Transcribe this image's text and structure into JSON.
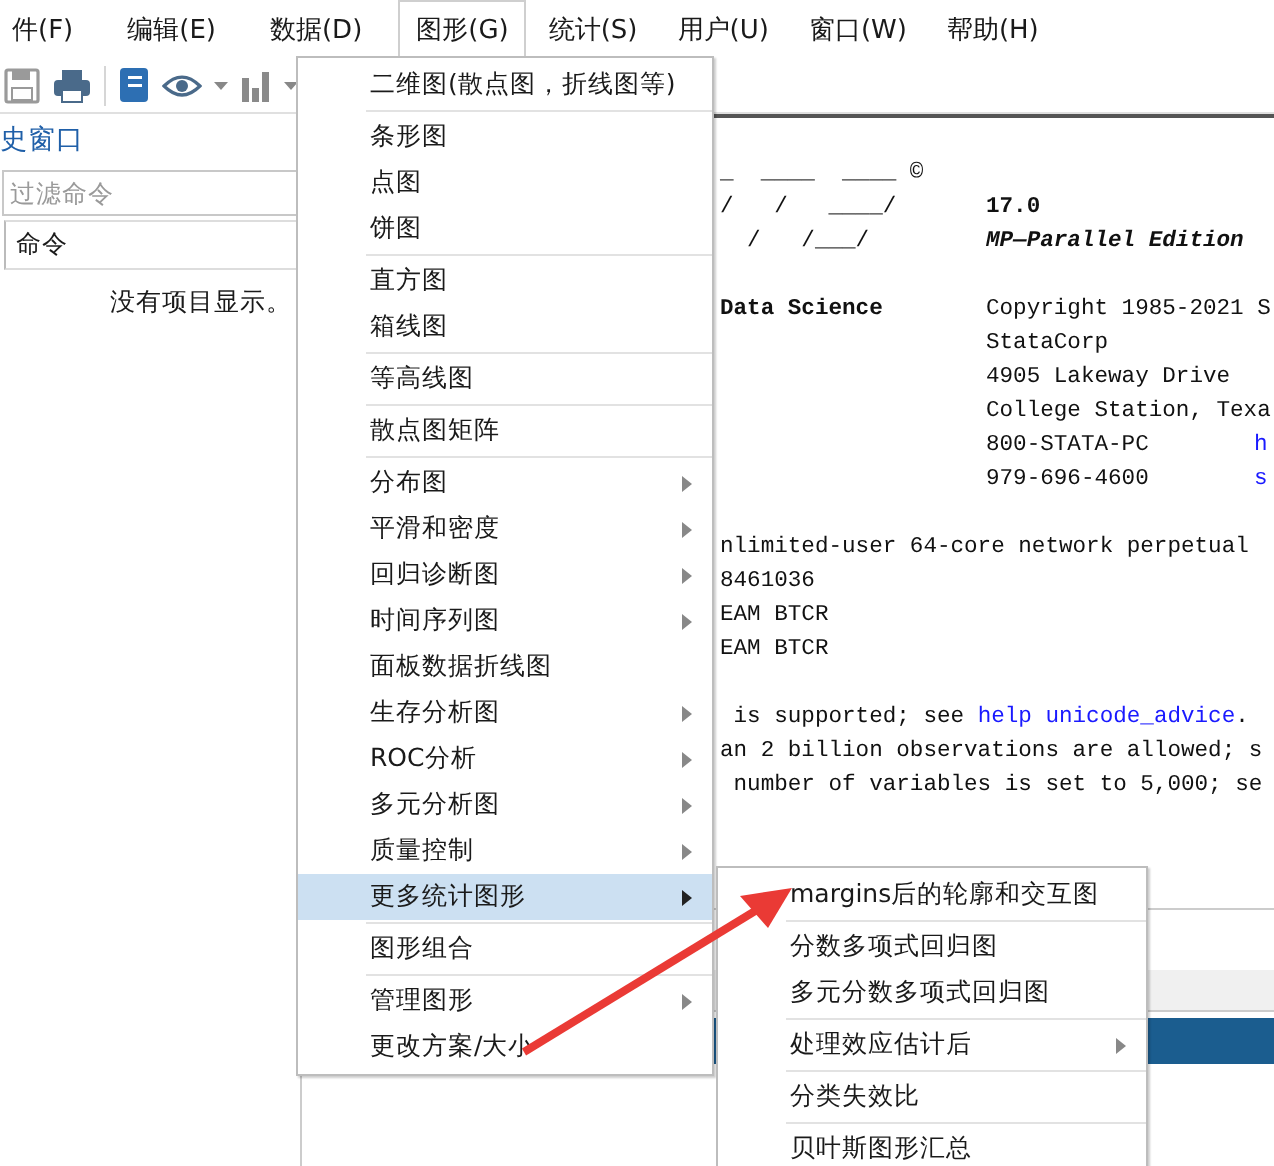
{
  "menubar": [
    {
      "label": "件(F)",
      "selected": false
    },
    {
      "label": "编辑(E)",
      "selected": false
    },
    {
      "label": "数据(D)",
      "selected": false
    },
    {
      "label": "图形(G)",
      "selected": true
    },
    {
      "label": "统计(S)",
      "selected": false
    },
    {
      "label": "用户(U)",
      "selected": false
    },
    {
      "label": "窗口(W)",
      "selected": false
    },
    {
      "label": "帮助(H)",
      "selected": false
    }
  ],
  "history_panel": {
    "title": "史窗口",
    "filter": {
      "placeholder": "过滤命令"
    },
    "column": "命令",
    "empty_message": "没有项目显示。"
  },
  "results": {
    "lines": [
      {
        "kind": "columns",
        "left": {
          "text": "_  ____  ____ ©",
          "kind": "text"
        }
      },
      {
        "kind": "columns",
        "left": {
          "text": "/   /   ____/",
          "kind": "text"
        },
        "middle": {
          "text": "17.0",
          "kind": "version"
        }
      },
      {
        "kind": "columns",
        "left": {
          "text": "  /   /___/",
          "kind": "text"
        },
        "middle": {
          "text": "MP—Parallel Edition",
          "kind": "edition"
        }
      },
      {
        "kind": "blank"
      },
      {
        "kind": "columns",
        "left": {
          "text": "Data Science",
          "kind": "version"
        },
        "middle": {
          "text": "Copyright 1985-2021 S",
          "kind": "text"
        }
      },
      {
        "kind": "columns",
        "middle": {
          "text": "StataCorp",
          "kind": "text"
        }
      },
      {
        "kind": "columns",
        "middle": {
          "text": "4905 Lakeway Drive",
          "kind": "text"
        }
      },
      {
        "kind": "columns",
        "middle": {
          "text": "College Station, Texa",
          "kind": "text"
        }
      },
      {
        "kind": "columns",
        "middle": {
          "text": "800-STATA-PC",
          "kind": "text"
        },
        "right": {
          "text": "h",
          "kind": "link"
        }
      },
      {
        "kind": "columns",
        "middle": {
          "text": "979-696-4600",
          "kind": "text"
        },
        "right": {
          "text": "s",
          "kind": "link"
        }
      },
      {
        "kind": "blank"
      },
      {
        "kind": "text",
        "text": "nlimited-user 64-core network perpetual"
      },
      {
        "kind": "text",
        "text": "8461036"
      },
      {
        "kind": "text",
        "text": "EAM BTCR"
      },
      {
        "kind": "text",
        "text": "EAM BTCR"
      },
      {
        "kind": "blank"
      },
      {
        "kind": "sentence",
        "before": " is supported; see ",
        "link": "help unicode_advice",
        "after": "."
      },
      {
        "kind": "text",
        "text": "an 2 billion observations are allowed; s"
      },
      {
        "kind": "text",
        "text": " number of variables is set to 5,000; se"
      }
    ]
  },
  "graphics_menu": {
    "groups": [
      [
        {
          "label": "二维图(散点图，折线图等)",
          "submenu": false,
          "selected": false
        }
      ],
      [
        {
          "label": "条形图",
          "submenu": false,
          "selected": false
        },
        {
          "label": "点图",
          "submenu": false,
          "selected": false
        },
        {
          "label": "饼图",
          "submenu": false,
          "selected": false
        }
      ],
      [
        {
          "label": "直方图",
          "submenu": false,
          "selected": false
        },
        {
          "label": "箱线图",
          "submenu": false,
          "selected": false
        }
      ],
      [
        {
          "label": "等高线图",
          "submenu": false,
          "selected": false
        }
      ],
      [
        {
          "label": "散点图矩阵",
          "submenu": false,
          "selected": false
        }
      ],
      [
        {
          "label": "分布图",
          "submenu": true,
          "selected": false
        },
        {
          "label": "平滑和密度",
          "submenu": true,
          "selected": false
        },
        {
          "label": "回归诊断图",
          "submenu": true,
          "selected": false
        },
        {
          "label": "时间序列图",
          "submenu": true,
          "selected": false
        },
        {
          "label": "面板数据折线图",
          "submenu": false,
          "selected": false
        },
        {
          "label": "生存分析图",
          "submenu": true,
          "selected": false
        },
        {
          "label": "ROC分析",
          "submenu": true,
          "selected": false
        },
        {
          "label": "多元分析图",
          "submenu": true,
          "selected": false
        },
        {
          "label": "质量控制",
          "submenu": true,
          "selected": false
        },
        {
          "label": "更多统计图形",
          "submenu": true,
          "selected": true
        }
      ],
      [
        {
          "label": "图形组合",
          "submenu": false,
          "selected": false
        }
      ],
      [
        {
          "label": "管理图形",
          "submenu": true,
          "selected": false
        },
        {
          "label": "更改方案/大小",
          "submenu": false,
          "selected": false
        }
      ]
    ]
  },
  "more_graphs_submenu": {
    "groups": [
      [
        {
          "label": "margins后的轮廓和交互图",
          "submenu": false,
          "selected": false
        }
      ],
      [
        {
          "label": "分数多项式回归图",
          "submenu": false,
          "selected": false
        },
        {
          "label": "多元分数多项式回归图",
          "submenu": false,
          "selected": false
        }
      ],
      [
        {
          "label": "处理效应估计后",
          "submenu": true,
          "selected": false
        }
      ],
      [
        {
          "label": "分类失效比",
          "submenu": false,
          "selected": false
        }
      ],
      [
        {
          "label": "贝叶斯图形汇总",
          "submenu": false,
          "selected": false
        }
      ]
    ]
  }
}
